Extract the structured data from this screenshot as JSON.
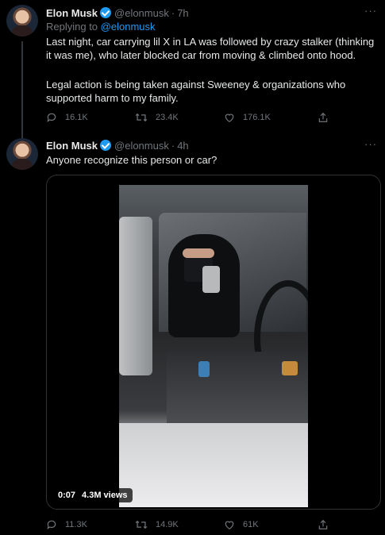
{
  "tweet1": {
    "name": "Elon Musk",
    "handle": "@elonmusk",
    "time": "7h",
    "replying_prefix": "Replying to",
    "replying_handle": "@elonmusk",
    "text_p1": "Last night, car carrying lil X in LA was followed by crazy stalker (thinking it was me), who later blocked car from moving & climbed onto hood.",
    "text_p2": "Legal action is being taken against Sweeney & organizations who supported harm to my family.",
    "replies": "16.1K",
    "retweets": "23.4K",
    "likes": "176.1K"
  },
  "tweet2": {
    "name": "Elon Musk",
    "handle": "@elonmusk",
    "time": "4h",
    "text": "Anyone recognize this person or car?",
    "video_time": "0:07",
    "video_views": "4.3M views",
    "replies": "11.3K",
    "retweets": "14.9K",
    "likes": "61K"
  },
  "separator_dot": "·",
  "more_glyph": "···",
  "icons": [
    "verified-badge-icon",
    "more-icon",
    "reply-icon",
    "retweet-icon",
    "like-icon",
    "share-icon"
  ],
  "colors": {
    "background": "#000000",
    "text": "#e7e9ea",
    "muted": "#71767b",
    "accent": "#1d9bf0"
  }
}
